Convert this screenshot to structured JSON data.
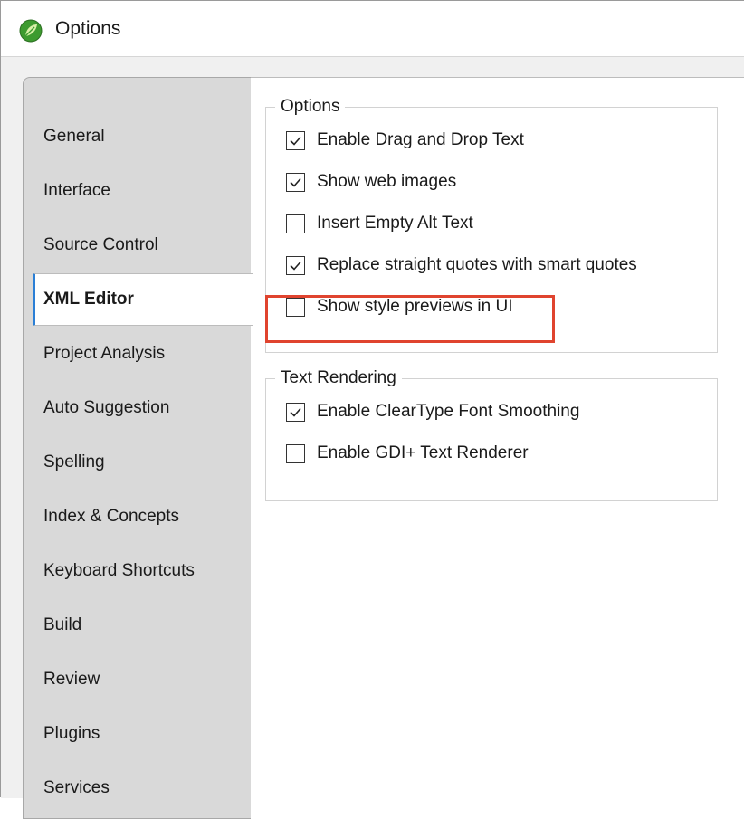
{
  "window": {
    "title": "Options",
    "icon": "leaf-logo-icon"
  },
  "tabs": [
    {
      "label": "General",
      "active": false
    },
    {
      "label": "Interface",
      "active": false
    },
    {
      "label": "Source Control",
      "active": false
    },
    {
      "label": "XML Editor",
      "active": true
    },
    {
      "label": "Project Analysis",
      "active": false
    },
    {
      "label": "Auto Suggestion",
      "active": false
    },
    {
      "label": "Spelling",
      "active": false
    },
    {
      "label": "Index & Concepts",
      "active": false
    },
    {
      "label": "Keyboard Shortcuts",
      "active": false
    },
    {
      "label": "Build",
      "active": false
    },
    {
      "label": "Review",
      "active": false
    },
    {
      "label": "Plugins",
      "active": false
    },
    {
      "label": "Services",
      "active": false
    }
  ],
  "groups": {
    "options": {
      "title": "Options",
      "items": [
        {
          "label": "Enable Drag and Drop Text",
          "checked": true
        },
        {
          "label": "Show web images",
          "checked": true
        },
        {
          "label": "Insert Empty Alt Text",
          "checked": false
        },
        {
          "label": "Replace straight quotes with smart quotes",
          "checked": true
        },
        {
          "label": "Show style previews in UI",
          "checked": false
        }
      ]
    },
    "text_rendering": {
      "title": "Text Rendering",
      "items": [
        {
          "label": "Enable ClearType Font Smoothing",
          "checked": true
        },
        {
          "label": "Enable GDI+ Text Renderer",
          "checked": false
        }
      ]
    }
  },
  "colors": {
    "highlight": "#e0442f",
    "active_tab_accent": "#2b7fd6",
    "logo_green": "#3d9b2f"
  }
}
